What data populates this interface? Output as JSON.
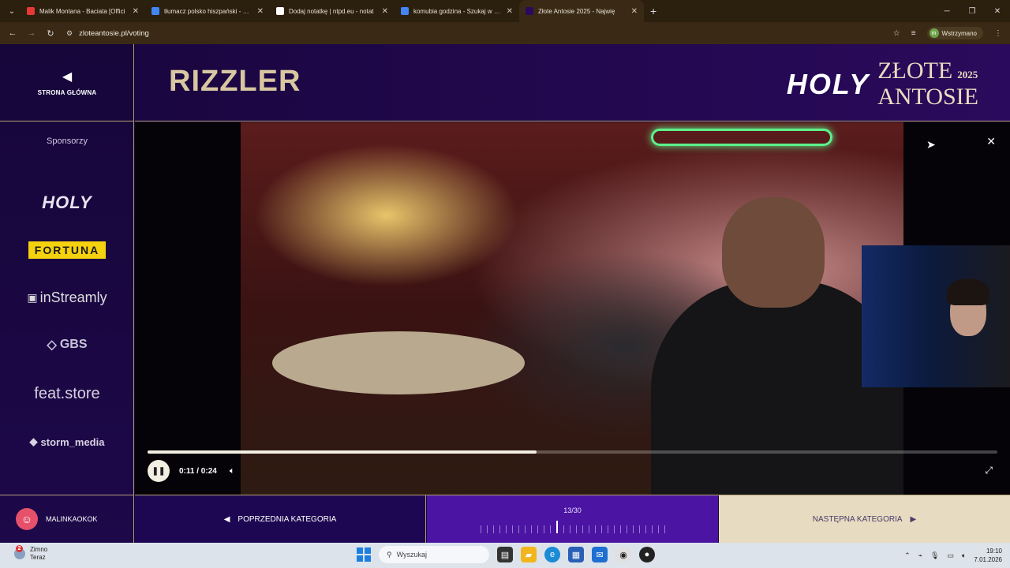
{
  "browser": {
    "tabs": [
      {
        "label": "Malik Montana - Baciata [Offici",
        "color": "#e53935",
        "active": false
      },
      {
        "label": "tłumacz polsko hiszpański - Szu",
        "color": "#4285f4",
        "active": false
      },
      {
        "label": "Dodaj notatkę | ntpd.eu - notat",
        "color": "#ffffff",
        "active": false
      },
      {
        "label": "komubia godzina - Szukaj w Go",
        "color": "#4285f4",
        "active": false
      },
      {
        "label": "Złote Antosie 2025 - Najwię",
        "color": "#2a0a5c",
        "active": true
      }
    ],
    "url": "zloteantosie.pl/voting",
    "profile_status": "Wstrzymano",
    "profile_initial": "m"
  },
  "sidebar": {
    "home_label": "STRONA GŁÓWNA",
    "sponsors_title": "Sponsorzy",
    "sponsors": [
      "HOLY",
      "FORTUNA",
      "inStreamly",
      "GBS",
      "feat.store",
      "storm_media"
    ],
    "username": "MALINKAOKOK"
  },
  "header": {
    "category_title": "RIZZLER",
    "brand_holy": "HOLY",
    "brand_line1": "ZŁOTE",
    "brand_line2": "ANTOSIE",
    "brand_year": "2025"
  },
  "player": {
    "time_display": "0:11 / 0:24",
    "progress_fraction": 0.458
  },
  "footer": {
    "prev_label": "POPRZEDNIA KATEGORIA",
    "counter": "13/30",
    "current": 13,
    "total": 30,
    "next_label": "NASTĘPNA KATEGORIA"
  },
  "taskbar": {
    "weather_title": "Zimno",
    "weather_sub": "Teraz",
    "weather_badge": "2",
    "search_placeholder": "Wyszukaj",
    "time": "19:10",
    "date": "7.01.2026"
  }
}
